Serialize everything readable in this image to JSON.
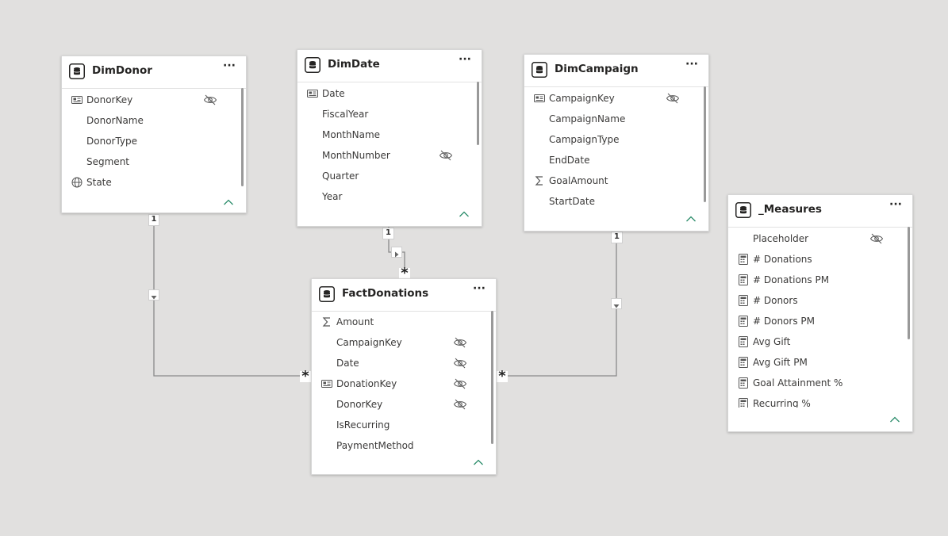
{
  "tables": {
    "dimdonor": {
      "title": "DimDonor",
      "more": "···",
      "fields": [
        "DonorKey",
        "DonorName",
        "DonorType",
        "Segment",
        "State"
      ]
    },
    "dimdate": {
      "title": "DimDate",
      "more": "···",
      "fields": [
        "Date",
        "FiscalYear",
        "MonthName",
        "MonthNumber",
        "Quarter",
        "Year"
      ]
    },
    "dimcampaign": {
      "title": "DimCampaign",
      "more": "···",
      "fields": [
        "CampaignKey",
        "CampaignName",
        "CampaignType",
        "EndDate",
        "GoalAmount",
        "StartDate"
      ]
    },
    "factdonations": {
      "title": "FactDonations",
      "more": "···",
      "fields": [
        "Amount",
        "CampaignKey",
        "Date",
        "DonationKey",
        "DonorKey",
        "IsRecurring",
        "PaymentMethod"
      ]
    },
    "measures": {
      "title": "_Measures",
      "more": "···",
      "fields": [
        "Placeholder",
        "# Donations",
        "# Donations PM",
        "# Donors",
        "# Donors PM",
        "Avg Gift",
        "Avg Gift PM",
        "Goal Attainment %",
        "Recurring %"
      ]
    }
  },
  "relationships": {
    "one_label": "1",
    "many_label": "*"
  },
  "colors": {
    "canvas": "#e1e0df",
    "line": "#8a8a8a",
    "collapse_chevron": "#2a8c6a"
  }
}
